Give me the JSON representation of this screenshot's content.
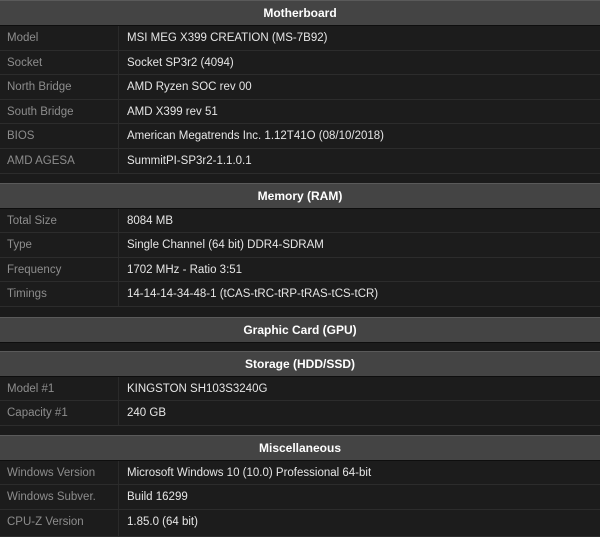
{
  "motherboard": {
    "title": "Motherboard",
    "rows": [
      {
        "label": "Model",
        "value": "MSI MEG X399 CREATION (MS-7B92)"
      },
      {
        "label": "Socket",
        "value": "Socket SP3r2 (4094)"
      },
      {
        "label": "North Bridge",
        "value": "AMD Ryzen SOC rev 00"
      },
      {
        "label": "South Bridge",
        "value": "AMD X399 rev 51"
      },
      {
        "label": "BIOS",
        "value": "American Megatrends Inc. 1.12T41O (08/10/2018)"
      },
      {
        "label": "AMD AGESA",
        "value": "SummitPI-SP3r2-1.1.0.1"
      }
    ]
  },
  "memory": {
    "title": "Memory (RAM)",
    "rows": [
      {
        "label": "Total Size",
        "value": "8084 MB"
      },
      {
        "label": "Type",
        "value": "Single Channel (64 bit) DDR4-SDRAM"
      },
      {
        "label": "Frequency",
        "value": "1702 MHz - Ratio 3:51"
      },
      {
        "label": "Timings",
        "value": "14-14-14-34-48-1 (tCAS-tRC-tRP-tRAS-tCS-tCR)"
      }
    ]
  },
  "graphic": {
    "title": "Graphic Card (GPU)"
  },
  "storage": {
    "title": "Storage (HDD/SSD)",
    "rows": [
      {
        "label": "Model #1",
        "value": "KINGSTON SH103S3240G"
      },
      {
        "label": "Capacity #1",
        "value": "240 GB"
      }
    ]
  },
  "misc": {
    "title": "Miscellaneous",
    "rows": [
      {
        "label": "Windows Version",
        "value": "Microsoft Windows 10 (10.0) Professional 64-bit"
      },
      {
        "label": "Windows Subver.",
        "value": "Build 16299"
      },
      {
        "label": "CPU-Z Version",
        "value": "1.85.0 (64 bit)"
      }
    ]
  }
}
